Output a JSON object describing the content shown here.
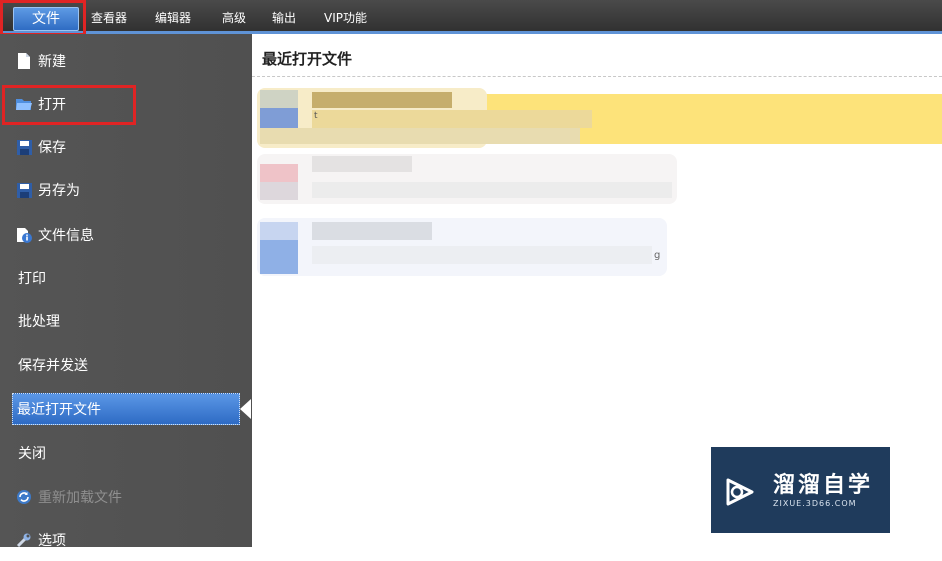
{
  "menubar": {
    "tabs": [
      {
        "label": "文件"
      },
      {
        "label": "查看器"
      },
      {
        "label": "编辑器"
      },
      {
        "label": "高级"
      },
      {
        "label": "输出"
      },
      {
        "label": "VIP功能"
      }
    ],
    "accent_color": "#5f93d6"
  },
  "sidebar": {
    "items": [
      {
        "label": "新建",
        "icon": "new-document-icon"
      },
      {
        "label": "打开",
        "icon": "open-folder-icon"
      },
      {
        "label": "保存",
        "icon": "save-disk-icon"
      },
      {
        "label": "另存为",
        "icon": "save-as-disk-icon"
      },
      {
        "label": "文件信息",
        "icon": "file-info-icon"
      },
      {
        "label": "打印"
      },
      {
        "label": "批处理"
      },
      {
        "label": "保存并发送"
      },
      {
        "label": "最近打开文件",
        "selected": true
      },
      {
        "label": "关闭"
      },
      {
        "label": "重新加载文件",
        "icon": "reload-icon",
        "disabled": true
      },
      {
        "label": "选项",
        "icon": "wrench-icon"
      }
    ]
  },
  "main": {
    "title": "最近打开文件",
    "recent_files": [
      {
        "state": "highlighted",
        "text": "t",
        "highlight_color": "#fde37a"
      },
      {
        "state": "normal",
        "text": ""
      },
      {
        "state": "normal",
        "text": "g"
      }
    ]
  },
  "watermark": {
    "title": "溜溜自学",
    "subtitle": "ZIXUE.3D66.COM"
  }
}
